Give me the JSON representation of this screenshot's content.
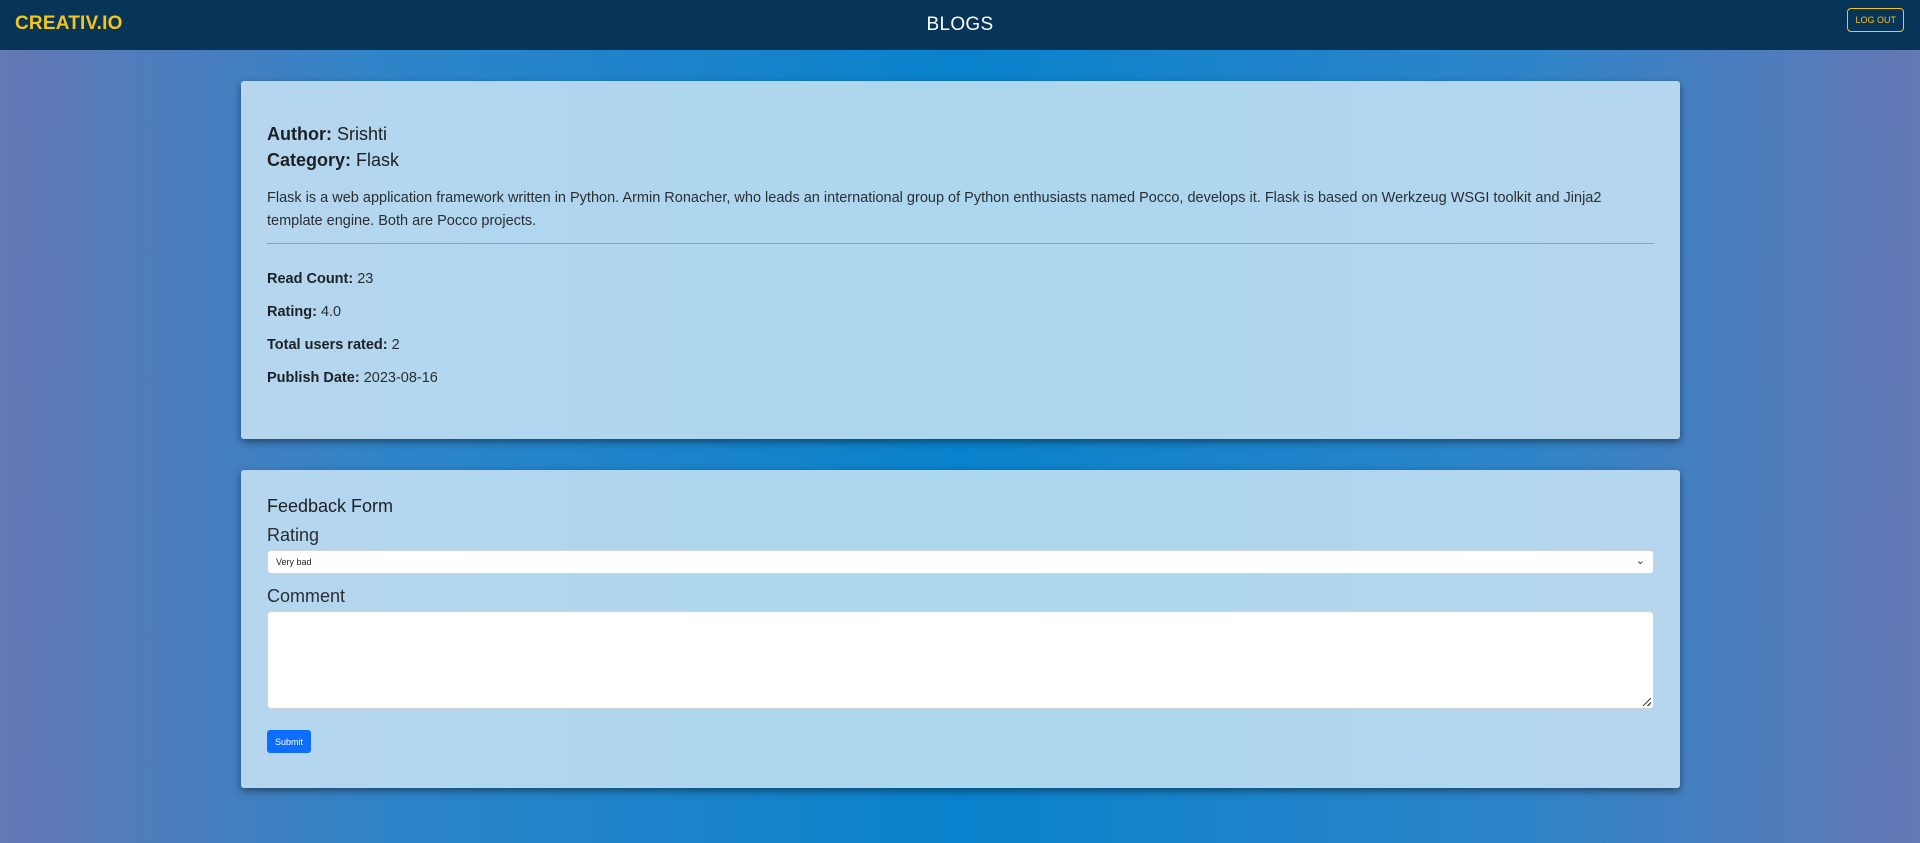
{
  "navbar": {
    "brand": "CREATIV.IO",
    "title": "BLOGS",
    "logout_label": "LOG OUT"
  },
  "blog": {
    "author_label": "Author:",
    "author": "Srishti",
    "category_label": "Category:",
    "category": "Flask",
    "description": "Flask is a web application framework written in Python. Armin Ronacher, who leads an international group of Python enthusiasts named Pocco, develops it. Flask is based on Werkzeug WSGI toolkit and Jinja2 template engine. Both are Pocco projects.",
    "stats": [
      {
        "label": "Read Count:",
        "value": "23"
      },
      {
        "label": "Rating:",
        "value": "4.0"
      },
      {
        "label": "Total users rated:",
        "value": "2"
      },
      {
        "label": "Publish Date:",
        "value": "2023-08-16"
      }
    ]
  },
  "feedback_form": {
    "title": "Feedback Form",
    "rating_label": "Rating",
    "rating_selected": "Very bad",
    "comment_label": "Comment",
    "comment_value": "",
    "submit_label": "Submit"
  },
  "colors": {
    "navbar_bg": "#073457",
    "brand_accent": "#f5c518",
    "primary_button": "#0d6efd"
  }
}
